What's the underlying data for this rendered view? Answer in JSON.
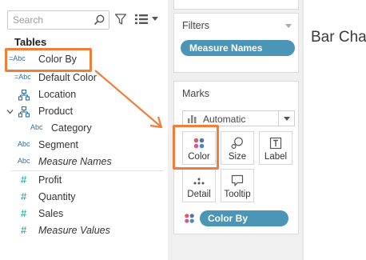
{
  "data_pane": {
    "search_placeholder": "Search",
    "tables_title": "Tables",
    "fields": [
      {
        "icon": "=Abc",
        "label": "Color By"
      },
      {
        "icon": "=Abc",
        "label": "Default Color"
      },
      {
        "icon": "globe",
        "label": "Location"
      },
      {
        "icon": "hierarchy",
        "label": "Product"
      },
      {
        "icon": "Abc",
        "label": "Category"
      },
      {
        "icon": "Abc",
        "label": "Segment"
      },
      {
        "icon": "Abc",
        "label": "Measure Names"
      },
      {
        "icon": "#",
        "label": "Profit"
      },
      {
        "icon": "#",
        "label": "Quantity"
      },
      {
        "icon": "#",
        "label": "Sales"
      },
      {
        "icon": "#",
        "label": "Measure Values"
      }
    ]
  },
  "filters": {
    "title": "Filters",
    "pill": "Measure Names"
  },
  "marks": {
    "title": "Marks",
    "mark_type": "Automatic",
    "buttons": {
      "color": "Color",
      "size": "Size",
      "label": "Label",
      "detail": "Detail",
      "tooltip": "Tooltip"
    },
    "color_pill": "Color By"
  },
  "view": {
    "title": "Bar Cha"
  },
  "colors": {
    "pill_blue": "#4b96b6",
    "highlight_orange": "#f07d3a",
    "dimension_blue": "#2e6d9e",
    "measure_green": "#00a08a"
  }
}
